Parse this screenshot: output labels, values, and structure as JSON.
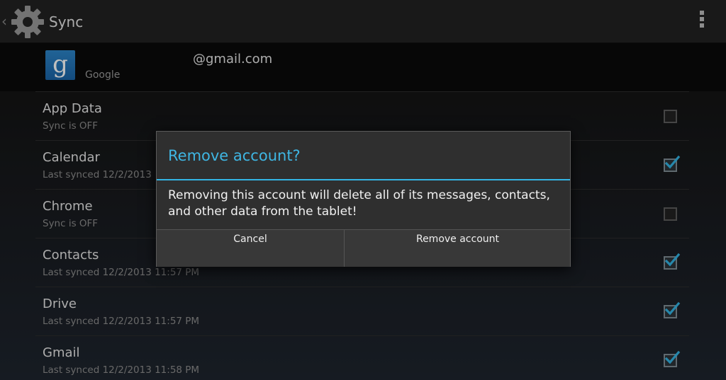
{
  "action_bar": {
    "title": "Sync",
    "up_icon": "chevron-left-icon",
    "app_icon": "gear-icon",
    "menu_icon": "overflow-menu-icon"
  },
  "account": {
    "icon_letter": "g",
    "type": "Google",
    "email": "@gmail.com"
  },
  "sync_items": [
    {
      "name": "App Data",
      "status": "Sync is OFF",
      "checked": false
    },
    {
      "name": "Calendar",
      "status": "Last synced 12/2/2013",
      "checked": true
    },
    {
      "name": "Chrome",
      "status": "Sync is OFF",
      "checked": false
    },
    {
      "name": "Contacts",
      "status": "Last synced 12/2/2013 11:57 PM",
      "checked": true
    },
    {
      "name": "Drive",
      "status": "Last synced 12/2/2013 11:57 PM",
      "checked": true
    },
    {
      "name": "Gmail",
      "status": "Last synced 12/2/2013 11:58 PM",
      "checked": true
    }
  ],
  "dialog": {
    "title": "Remove account?",
    "message": "Removing this account will delete all of its messages, contacts, and other data from the tablet!",
    "cancel_label": "Cancel",
    "confirm_label": "Remove account"
  },
  "colors": {
    "accent": "#33b5e5",
    "title_text": "#3fb6e3",
    "google_blue": "#2c85c9"
  }
}
